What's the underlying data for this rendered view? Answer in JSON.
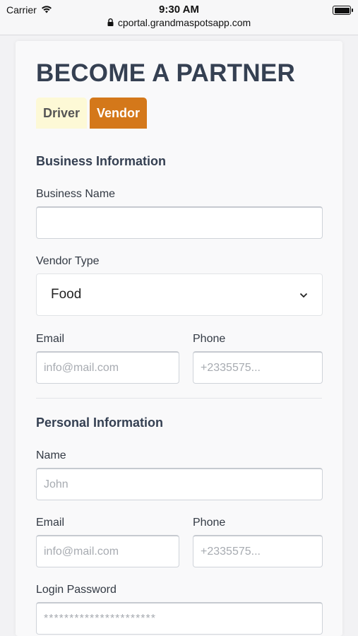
{
  "status_bar": {
    "carrier": "Carrier",
    "time": "9:30 AM",
    "url": "cportal.grandmaspotsapp.com"
  },
  "page": {
    "title": "BECOME A PARTNER",
    "tabs": [
      {
        "label": "Driver",
        "active": false
      },
      {
        "label": "Vendor",
        "active": true
      }
    ]
  },
  "business": {
    "section_title": "Business Information",
    "business_name_label": "Business Name",
    "business_name_value": "",
    "vendor_type_label": "Vendor Type",
    "vendor_type_value": "Food",
    "email_label": "Email",
    "email_placeholder": "info@mail.com",
    "phone_label": "Phone",
    "phone_placeholder": "+2335575..."
  },
  "personal": {
    "section_title": "Personal Information",
    "name_label": "Name",
    "name_placeholder": "John",
    "email_label": "Email",
    "email_placeholder": "info@mail.com",
    "phone_label": "Phone",
    "phone_placeholder": "+2335575...",
    "password_label": "Login Password",
    "password_placeholder": "**********************"
  },
  "colors": {
    "accent": "#d4781a",
    "driver_tab_bg": "#fdf9d6",
    "heading": "#354052"
  }
}
